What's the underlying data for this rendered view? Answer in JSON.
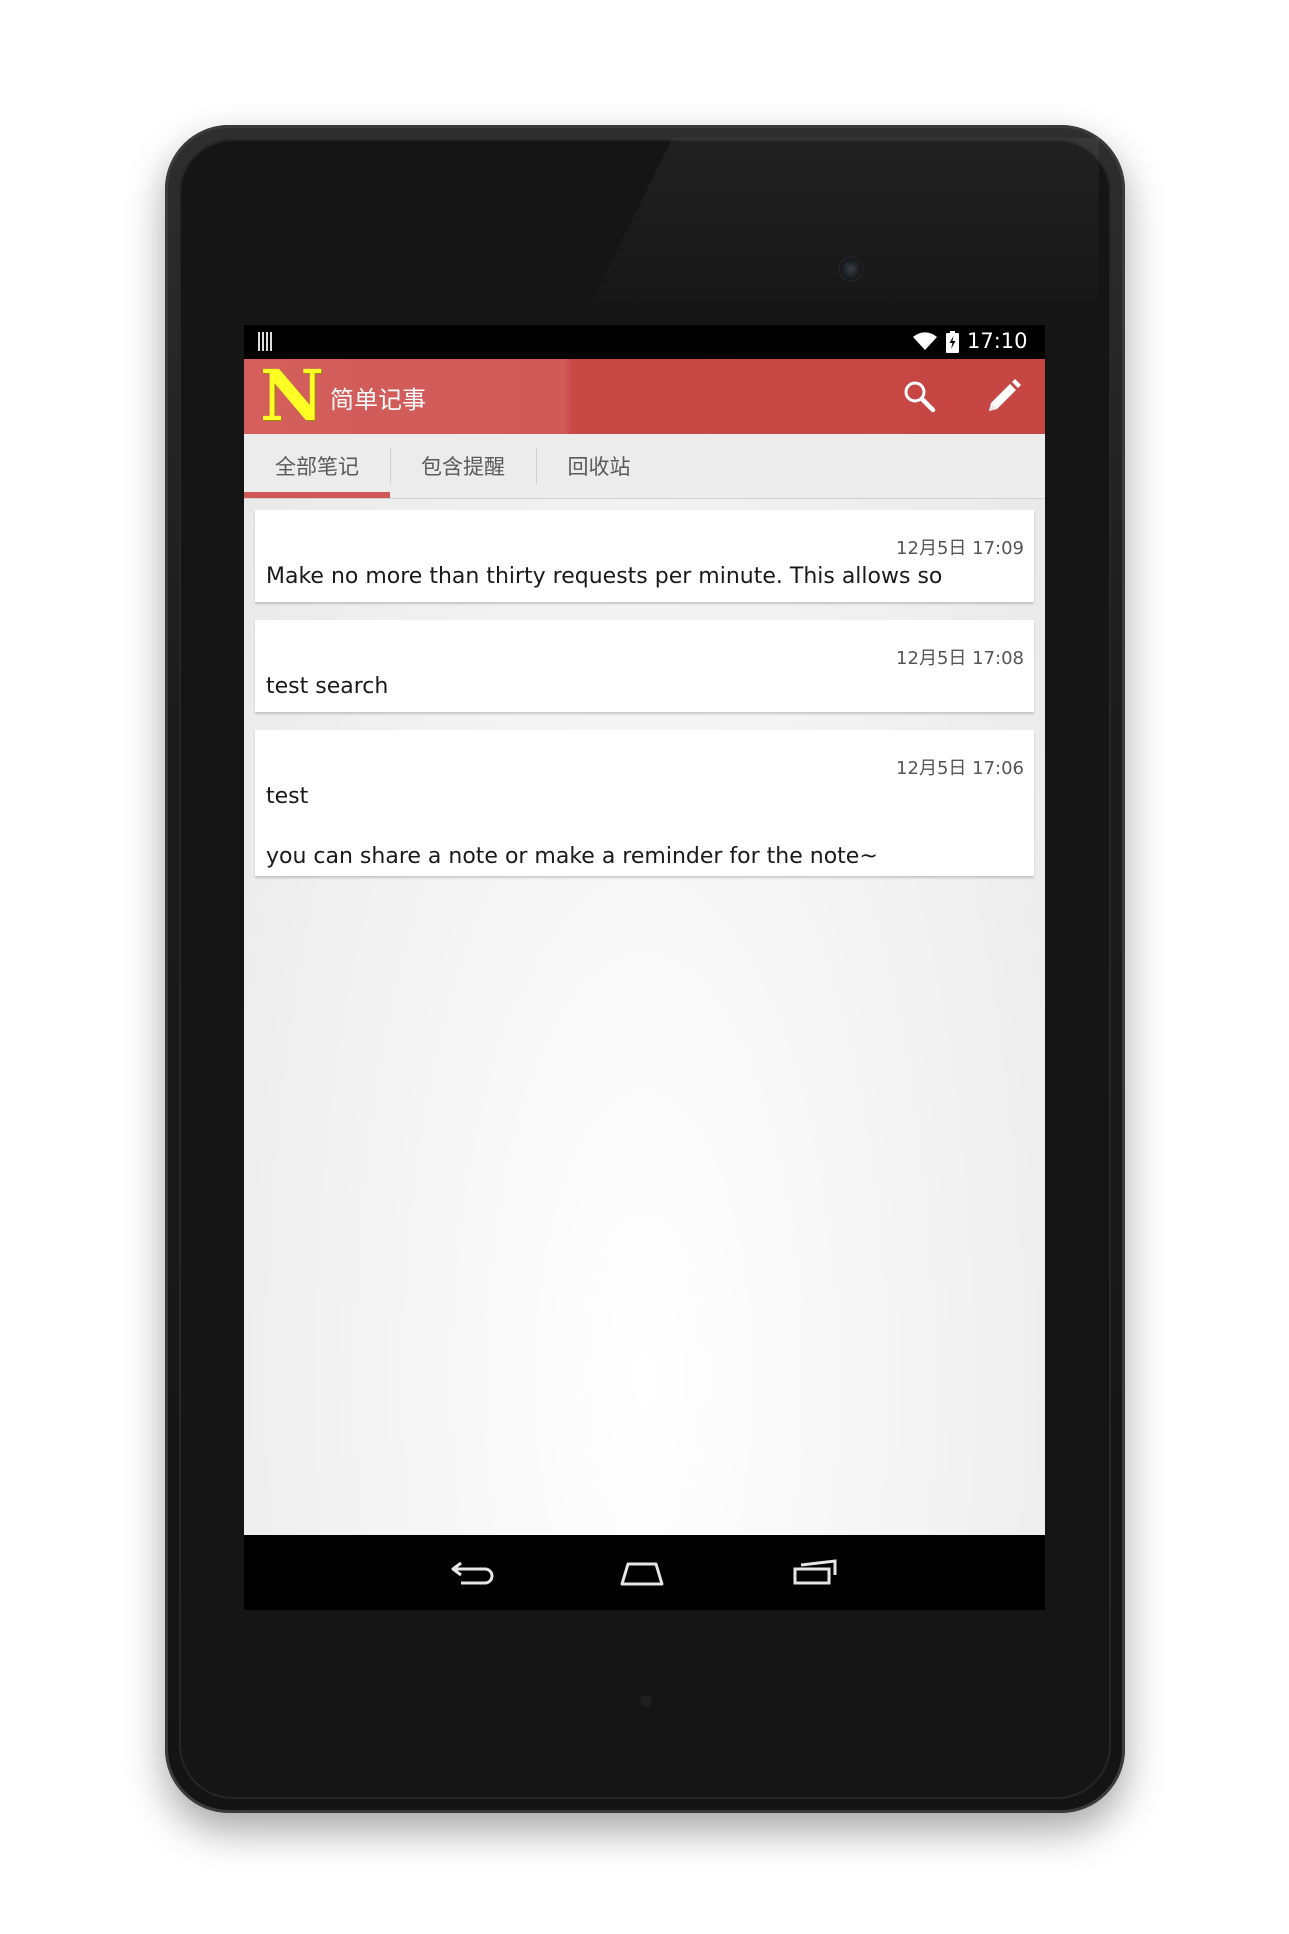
{
  "status_bar": {
    "time": "17:10"
  },
  "action_bar": {
    "logo_letter": "N",
    "title": "简单记事",
    "search_icon": "search-icon",
    "new_note_icon": "pencil-icon"
  },
  "tabs": [
    {
      "label": "全部笔记",
      "selected": true
    },
    {
      "label": "包含提醒",
      "selected": false
    },
    {
      "label": "回收站",
      "selected": false
    }
  ],
  "notes": [
    {
      "time": "12月5日 17:09",
      "text": "Make no more than thirty requests per minute. This allows so"
    },
    {
      "time": "12月5日 17:08",
      "text": "test search"
    },
    {
      "time": "12月5日 17:06",
      "text": "test\n\nyou can share a note or make a reminder for the note~"
    }
  ],
  "navigation_bar": {
    "back_icon": "back-icon",
    "home_icon": "home-icon",
    "recents_icon": "recents-icon"
  },
  "colors": {
    "action_bar": "#cd4c4a",
    "logo": "#ffff26",
    "tab_indicator": "#cd5855"
  }
}
